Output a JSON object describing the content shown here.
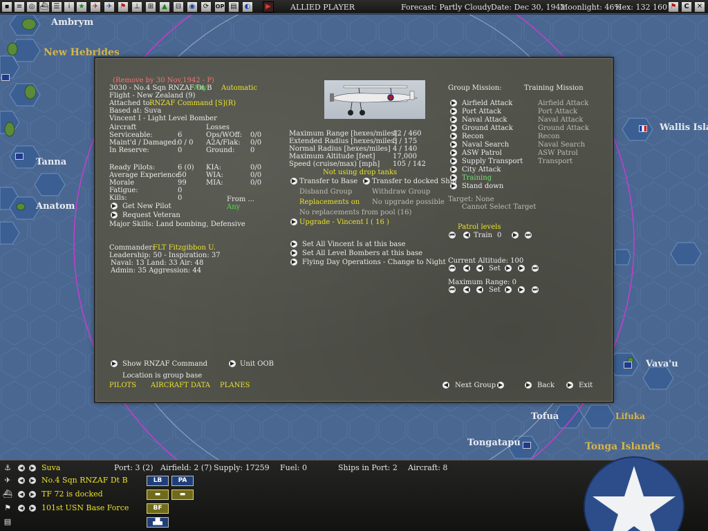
{
  "topbar": {
    "player": "ALLIED PLAYER",
    "forecast": "Forecast: Partly Cloudy",
    "date": "Date: Dec 30, 1942",
    "moonlight": "Moonlight: 46%",
    "hex": "Hex: 132 160",
    "icons": [
      "square-icon",
      "document-icon",
      "target-icon",
      "ship-icon",
      "info-icon",
      "star-icon",
      "plane-icon",
      "plane-icon",
      "flag-icon",
      "chart-icon",
      "map-icon",
      "group-icon",
      "globe-icon",
      "cycle-icon",
      "op-icon",
      "list-icon",
      "moon-icon",
      "play-icon"
    ],
    "right_icons": [
      "flag-icon",
      "c-icon",
      "close-icon"
    ],
    "op_label": "OP"
  },
  "map": {
    "labels": {
      "ambrym": "Ambrym",
      "new_hebrides": "New Hebrides",
      "tanna": "Tanna",
      "anatom": "Anatom",
      "wallis": "Wallis Islan",
      "vavau": "Vava'u",
      "tofua": "Tofua",
      "lifuka": "Lifuka",
      "tongatapu": "Tongatapu",
      "tonga_islands": "Tonga Islands"
    }
  },
  "dialog": {
    "removal_note": "(Remove by 30 Nov,1942 - P)",
    "unit_title": "3030 - No.4 Sqn RNZAF Dt B",
    "unit_any": "Any",
    "unit_auto": "Automatic",
    "flight": "Flight - New Zealand (9)",
    "attached_label": "Attached to:",
    "attached_value": "RNZAF Command [S](R)",
    "based_at": "Based at: Suva",
    "aircraft_type": "Vincent I - Light Level Bomber",
    "aircraft": {
      "header": "Aircraft",
      "rows": [
        {
          "label": "Serviceable:",
          "value": "6"
        },
        {
          "label": "Maint'd / Damaged:",
          "value": "0 / 0"
        },
        {
          "label": "In Reserve:",
          "value": "0"
        }
      ]
    },
    "losses": {
      "header": "Losses",
      "rows": [
        {
          "label": "Ops/WOff:",
          "value": "0/0"
        },
        {
          "label": "A2A/Flak:",
          "value": "0/0"
        },
        {
          "label": "Ground:",
          "value": "0"
        }
      ]
    },
    "pilots": {
      "rows": [
        {
          "label": "Ready Pilots:",
          "value": "6 (0)"
        },
        {
          "label": "Average Experience",
          "value": "50"
        },
        {
          "label": "Morale",
          "value": "99"
        },
        {
          "label": "Fatigue:",
          "value": "0"
        },
        {
          "label": "Kills:",
          "value": "0"
        }
      ]
    },
    "casualties": {
      "rows": [
        {
          "label": "KIA:",
          "value": "0/0"
        },
        {
          "label": "WIA:",
          "value": "0/0"
        },
        {
          "label": "MIA:",
          "value": "0/0"
        }
      ]
    },
    "from_label": "From ...",
    "from_value": "Any",
    "get_new_pilot": "Get New Pilot",
    "request_veteran": "Request Veteran",
    "major_skills": "Major Skills:  Land bombing, Defensive",
    "commander_label": "Commander:",
    "commander_value": "FLT Fitzgibbon U.",
    "leadership": "Leadership: 50 - Inspiration: 37",
    "naval_land_air": "Naval: 13  Land: 33  Air: 48",
    "admin_aggr": "Admin: 35  Aggression: 44",
    "range_stats": [
      {
        "label": "Maximum Range [hexes/miles]",
        "value": "12 / 460"
      },
      {
        "label": "Extended Radius [hexes/miles]",
        "value": "5 / 175"
      },
      {
        "label": "Normal Radius [hexes/miles]",
        "value": "4 / 140"
      },
      {
        "label": "Maximum Altitude [feet]",
        "value": "17,000"
      },
      {
        "label": "Speed (cruise/max) [mph]",
        "value": "105 / 142"
      }
    ],
    "drop_tanks": "Not using drop tanks",
    "transfer_base": "Transfer to Base",
    "transfer_ship": "Transfer to docked Ship",
    "disband": "Disband Group",
    "withdraw": "Withdraw Group",
    "replacements": "Replacements on",
    "no_upgrade": "No upgrade possible",
    "no_replacements": "No replacements from pool (16)",
    "upgrade": "Upgrade - Vincent I  ( 16 )",
    "set_all_vincent": "Set All Vincent Is at this base",
    "set_all_level": "Set All Level Bombers at this base",
    "flying_day": "Flying Day Operations - Change to Night",
    "group_mission_label": "Group Mission:",
    "group_mission_value": "Training Mission",
    "missions": [
      {
        "label": "Airfield Attack",
        "alt": "Airfield Attack"
      },
      {
        "label": "Port Attack",
        "alt": "Port Attack"
      },
      {
        "label": "Naval Attack",
        "alt": "Naval Attack"
      },
      {
        "label": "Ground Attack",
        "alt": "Ground Attack"
      },
      {
        "label": "Recon",
        "alt": "Recon"
      },
      {
        "label": "Naval Search",
        "alt": "Naval Search"
      },
      {
        "label": "ASW Patrol",
        "alt": "ASW Patrol"
      },
      {
        "label": "Supply Transport",
        "alt": "Transport"
      },
      {
        "label": "City Attack",
        "alt": ""
      },
      {
        "label": "Training",
        "alt": ""
      },
      {
        "label": "Stand down",
        "alt": ""
      }
    ],
    "target": "Target: None",
    "cannot_select": "Cannot Select Target",
    "patrol_levels": "Patrol levels",
    "train_label": "Train",
    "train_value": "0",
    "current_altitude": "Current Altitude: 100",
    "set_label": "Set",
    "max_range": "Maximum Range: 0",
    "show_command": "Show RNZAF Command",
    "unit_oob": "Unit OOB",
    "location_group_base": "Location is group base",
    "tab_pilots": "PILOTS",
    "tab_aircraft_data": "AIRCRAFT DATA",
    "tab_planes": "PLANES",
    "next_group": "Next Group",
    "back": "Back",
    "exit": "Exit"
  },
  "bottombar": {
    "base": "Suva",
    "port": "Port: 3 (2)",
    "airfield": "Airfield: 2 (7)",
    "supply": "Supply: 17259",
    "fuel": "Fuel: 0",
    "ships_in_port": "Ships in Port: 2",
    "aircraft": "Aircraft: 8",
    "air_unit": "No.4 Sqn RNZAF Dt B",
    "task_force": "TF 72 is docked",
    "land_unit": "101st USN Base Force",
    "badges": {
      "lb": "LB",
      "pa": "PA",
      "bf": "BF"
    }
  },
  "colors": {
    "ocean": "#4a6791",
    "hex_ocean": "#3b5f93",
    "dialog_bg": "#51524a",
    "highlight_yellow": "#ebe22a",
    "highlight_green": "#4ce04c",
    "highlight_red": "#ff7070"
  }
}
